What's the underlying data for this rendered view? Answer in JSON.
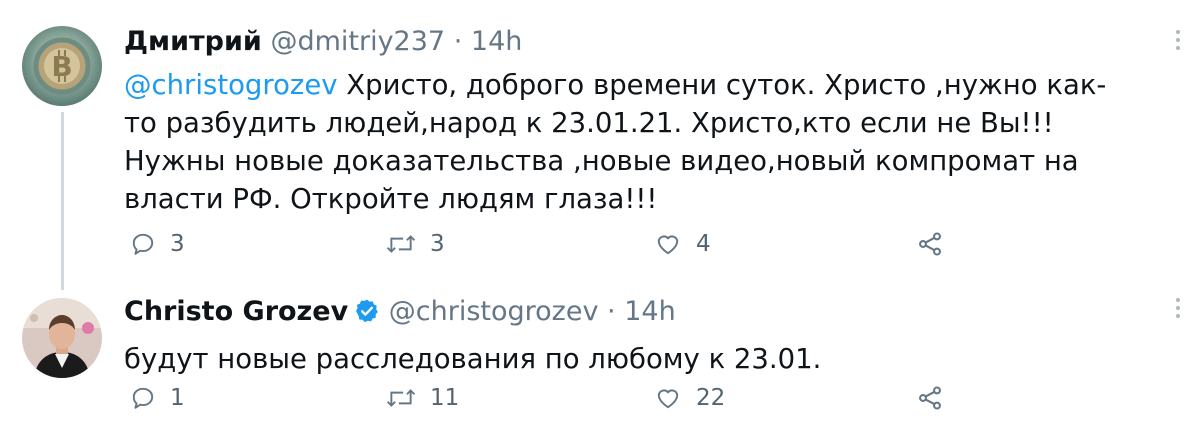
{
  "tweets": [
    {
      "display_name": "Дмитрий",
      "handle": "@dmitriy237",
      "separator": "·",
      "time": "14h",
      "mention": "@christogrozev",
      "text": " Христо, доброго времени суток. Христо ,нужно как-то разбудить людей,народ к 23.01.21. Христо,кто если не Вы!!! Нужны новые доказательства ,новые видео,новый компромат на власти РФ.  Откройте людям глаза!!!",
      "replies": "3",
      "retweets": "3",
      "likes": "4",
      "verified": false
    },
    {
      "display_name": "Christo Grozev",
      "handle": "@christogrozev",
      "separator": "·",
      "time": "14h",
      "text": "будут новые расследования по любому к 23.01.",
      "replies": "1",
      "retweets": "11",
      "likes": "22",
      "verified": true
    }
  ],
  "icons": {
    "reply": "reply-icon",
    "retweet": "retweet-icon",
    "like": "heart-icon",
    "share": "share-icon",
    "verified": "verified-badge-icon",
    "more": "more-options-icon"
  },
  "colors": {
    "link": "#1d9bf0",
    "muted": "#657786",
    "verified": "#1d9bf0",
    "thread_line": "#cfd9de"
  }
}
